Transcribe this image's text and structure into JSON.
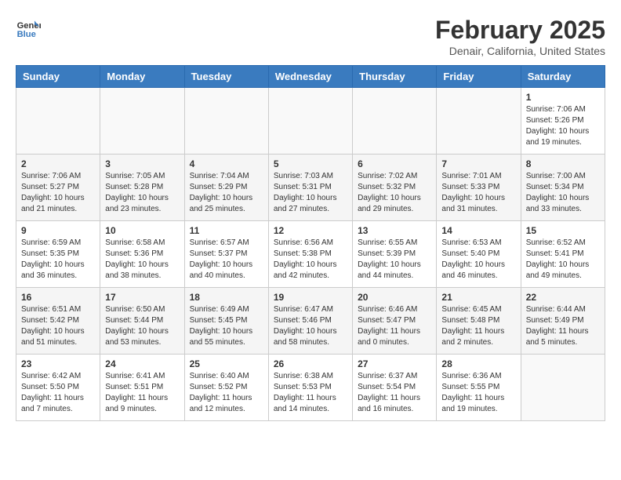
{
  "logo": {
    "line1": "General",
    "line2": "Blue"
  },
  "title": "February 2025",
  "location": "Denair, California, United States",
  "weekdays": [
    "Sunday",
    "Monday",
    "Tuesday",
    "Wednesday",
    "Thursday",
    "Friday",
    "Saturday"
  ],
  "weeks": [
    [
      {
        "day": "",
        "info": ""
      },
      {
        "day": "",
        "info": ""
      },
      {
        "day": "",
        "info": ""
      },
      {
        "day": "",
        "info": ""
      },
      {
        "day": "",
        "info": ""
      },
      {
        "day": "",
        "info": ""
      },
      {
        "day": "1",
        "info": "Sunrise: 7:06 AM\nSunset: 5:26 PM\nDaylight: 10 hours\nand 19 minutes."
      }
    ],
    [
      {
        "day": "2",
        "info": "Sunrise: 7:06 AM\nSunset: 5:27 PM\nDaylight: 10 hours\nand 21 minutes."
      },
      {
        "day": "3",
        "info": "Sunrise: 7:05 AM\nSunset: 5:28 PM\nDaylight: 10 hours\nand 23 minutes."
      },
      {
        "day": "4",
        "info": "Sunrise: 7:04 AM\nSunset: 5:29 PM\nDaylight: 10 hours\nand 25 minutes."
      },
      {
        "day": "5",
        "info": "Sunrise: 7:03 AM\nSunset: 5:31 PM\nDaylight: 10 hours\nand 27 minutes."
      },
      {
        "day": "6",
        "info": "Sunrise: 7:02 AM\nSunset: 5:32 PM\nDaylight: 10 hours\nand 29 minutes."
      },
      {
        "day": "7",
        "info": "Sunrise: 7:01 AM\nSunset: 5:33 PM\nDaylight: 10 hours\nand 31 minutes."
      },
      {
        "day": "8",
        "info": "Sunrise: 7:00 AM\nSunset: 5:34 PM\nDaylight: 10 hours\nand 33 minutes."
      }
    ],
    [
      {
        "day": "9",
        "info": "Sunrise: 6:59 AM\nSunset: 5:35 PM\nDaylight: 10 hours\nand 36 minutes."
      },
      {
        "day": "10",
        "info": "Sunrise: 6:58 AM\nSunset: 5:36 PM\nDaylight: 10 hours\nand 38 minutes."
      },
      {
        "day": "11",
        "info": "Sunrise: 6:57 AM\nSunset: 5:37 PM\nDaylight: 10 hours\nand 40 minutes."
      },
      {
        "day": "12",
        "info": "Sunrise: 6:56 AM\nSunset: 5:38 PM\nDaylight: 10 hours\nand 42 minutes."
      },
      {
        "day": "13",
        "info": "Sunrise: 6:55 AM\nSunset: 5:39 PM\nDaylight: 10 hours\nand 44 minutes."
      },
      {
        "day": "14",
        "info": "Sunrise: 6:53 AM\nSunset: 5:40 PM\nDaylight: 10 hours\nand 46 minutes."
      },
      {
        "day": "15",
        "info": "Sunrise: 6:52 AM\nSunset: 5:41 PM\nDaylight: 10 hours\nand 49 minutes."
      }
    ],
    [
      {
        "day": "16",
        "info": "Sunrise: 6:51 AM\nSunset: 5:42 PM\nDaylight: 10 hours\nand 51 minutes."
      },
      {
        "day": "17",
        "info": "Sunrise: 6:50 AM\nSunset: 5:44 PM\nDaylight: 10 hours\nand 53 minutes."
      },
      {
        "day": "18",
        "info": "Sunrise: 6:49 AM\nSunset: 5:45 PM\nDaylight: 10 hours\nand 55 minutes."
      },
      {
        "day": "19",
        "info": "Sunrise: 6:47 AM\nSunset: 5:46 PM\nDaylight: 10 hours\nand 58 minutes."
      },
      {
        "day": "20",
        "info": "Sunrise: 6:46 AM\nSunset: 5:47 PM\nDaylight: 11 hours\nand 0 minutes."
      },
      {
        "day": "21",
        "info": "Sunrise: 6:45 AM\nSunset: 5:48 PM\nDaylight: 11 hours\nand 2 minutes."
      },
      {
        "day": "22",
        "info": "Sunrise: 6:44 AM\nSunset: 5:49 PM\nDaylight: 11 hours\nand 5 minutes."
      }
    ],
    [
      {
        "day": "23",
        "info": "Sunrise: 6:42 AM\nSunset: 5:50 PM\nDaylight: 11 hours\nand 7 minutes."
      },
      {
        "day": "24",
        "info": "Sunrise: 6:41 AM\nSunset: 5:51 PM\nDaylight: 11 hours\nand 9 minutes."
      },
      {
        "day": "25",
        "info": "Sunrise: 6:40 AM\nSunset: 5:52 PM\nDaylight: 11 hours\nand 12 minutes."
      },
      {
        "day": "26",
        "info": "Sunrise: 6:38 AM\nSunset: 5:53 PM\nDaylight: 11 hours\nand 14 minutes."
      },
      {
        "day": "27",
        "info": "Sunrise: 6:37 AM\nSunset: 5:54 PM\nDaylight: 11 hours\nand 16 minutes."
      },
      {
        "day": "28",
        "info": "Sunrise: 6:36 AM\nSunset: 5:55 PM\nDaylight: 11 hours\nand 19 minutes."
      },
      {
        "day": "",
        "info": ""
      }
    ]
  ]
}
